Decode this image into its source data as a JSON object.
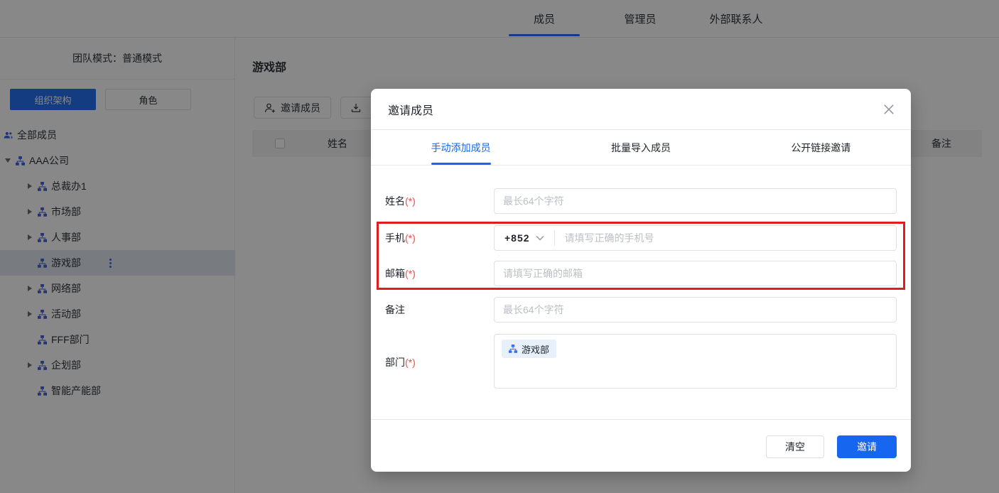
{
  "topnav": {
    "tabs": [
      {
        "label": "成员",
        "active": true
      },
      {
        "label": "管理员",
        "active": false
      },
      {
        "label": "外部联系人",
        "active": false
      }
    ]
  },
  "sidebar": {
    "mode_label": "团队模式：普通模式",
    "org_button": "组织架构",
    "role_button": "角色",
    "tree": [
      {
        "label": "全部成员"
      },
      {
        "label": "AAA公司"
      },
      {
        "label": "总裁办1"
      },
      {
        "label": "市场部"
      },
      {
        "label": "人事部"
      },
      {
        "label": "游戏部",
        "selected": true
      },
      {
        "label": "网络部"
      },
      {
        "label": "活动部"
      },
      {
        "label": "FFF部门"
      },
      {
        "label": "企划部"
      },
      {
        "label": "智能产能部"
      }
    ]
  },
  "main": {
    "title": "游戏部",
    "invite_button": "邀请成员",
    "table": {
      "columns": [
        "姓名",
        "备注"
      ]
    }
  },
  "modal": {
    "title": "邀请成员",
    "tabs": [
      {
        "label": "手动添加成员",
        "active": true
      },
      {
        "label": "批量导入成员",
        "active": false
      },
      {
        "label": "公开链接邀请",
        "active": false
      }
    ],
    "fields": {
      "name": {
        "label": "姓名",
        "required": "(*)",
        "placeholder": "最长64个字符"
      },
      "phone": {
        "label": "手机",
        "required": "(*)",
        "country_code": "+852",
        "placeholder": "请填写正确的手机号"
      },
      "email": {
        "label": "邮箱",
        "required": "(*)",
        "placeholder": "请填写正确的邮箱"
      },
      "remark": {
        "label": "备注",
        "placeholder": "最长64个字符"
      },
      "department": {
        "label": "部门",
        "required": "(*)",
        "chip": "游戏部"
      }
    },
    "footer": {
      "clear_button": "清空",
      "invite_button": "邀请"
    }
  },
  "colors": {
    "accent_blue": "#1766F0",
    "icon_blue": "#2E5BE6",
    "required_red": "#F54A45",
    "annotation_red": "#E31C1C",
    "selected_row_bg": "#DFE6EF"
  }
}
